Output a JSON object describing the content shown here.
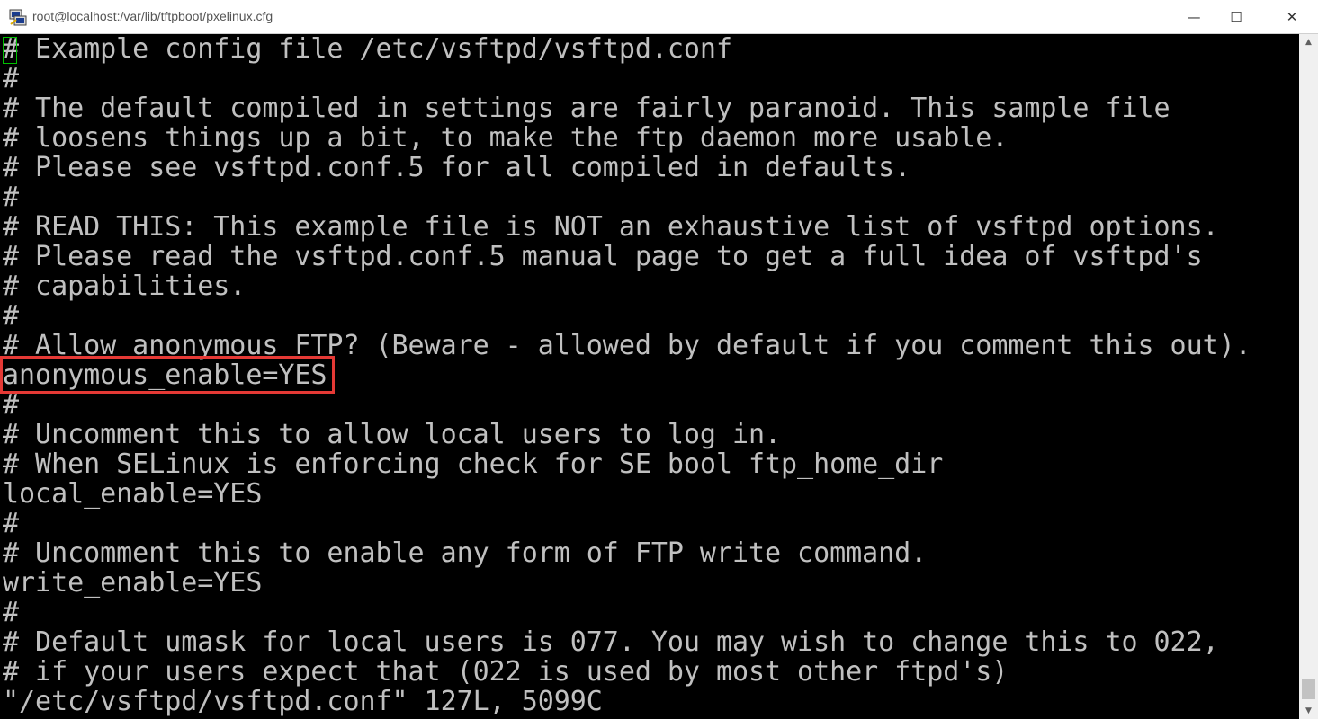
{
  "window": {
    "title": "root@localhost:/var/lib/tftpboot/pxelinux.cfg",
    "app_icon": "putty-icon",
    "controls": {
      "minimize": "—",
      "maximize": "☐",
      "close": "✕"
    }
  },
  "terminal": {
    "lines": [
      "# Example config file /etc/vsftpd/vsftpd.conf",
      "#",
      "# The default compiled in settings are fairly paranoid. This sample file",
      "# loosens things up a bit, to make the ftp daemon more usable.",
      "# Please see vsftpd.conf.5 for all compiled in defaults.",
      "#",
      "# READ THIS: This example file is NOT an exhaustive list of vsftpd options.",
      "# Please read the vsftpd.conf.5 manual page to get a full idea of vsftpd's",
      "# capabilities.",
      "#",
      "# Allow anonymous FTP? (Beware - allowed by default if you comment this out).",
      "anonymous_enable=YES",
      "#",
      "# Uncomment this to allow local users to log in.",
      "# When SELinux is enforcing check for SE bool ftp_home_dir",
      "local_enable=YES",
      "#",
      "# Uncomment this to enable any form of FTP write command.",
      "write_enable=YES",
      "#",
      "# Default umask for local users is 077. You may wish to change this to 022,",
      "# if your users expect that (022 is used by most other ftpd's)",
      "\"/etc/vsftpd/vsftpd.conf\" 127L, 5099C"
    ],
    "highlighted_line_index": 11
  },
  "colors": {
    "terminal_bg": "#000000",
    "terminal_fg": "#c0c0c0",
    "cursor": "#00c000",
    "highlight_box": "#e53935"
  },
  "scrollbar": {
    "up_arrow": "▲",
    "down_arrow": "▼"
  }
}
